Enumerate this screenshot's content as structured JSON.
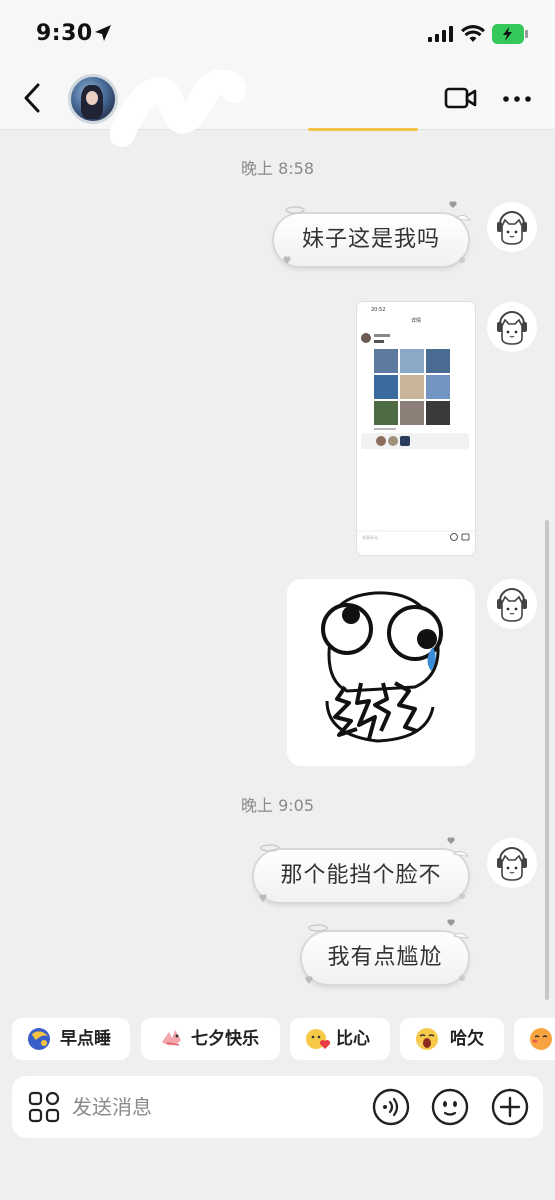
{
  "status_bar": {
    "time": "9:30"
  },
  "chat": {
    "messages": [
      {
        "type": "timestamp",
        "text": "晚上 8:58"
      },
      {
        "type": "text",
        "text": "妹子这是我吗"
      },
      {
        "type": "image",
        "content": "screenshot"
      },
      {
        "type": "image",
        "content": "meme-sticker"
      },
      {
        "type": "timestamp",
        "text": "晚上 9:05"
      },
      {
        "type": "text",
        "text": "那个能挡个脸不"
      },
      {
        "type": "text",
        "text": "我有点尴尬"
      }
    ],
    "screenshot_preview": {
      "time": "20:52",
      "title": "详情",
      "comment_placeholder": "发表评论..."
    }
  },
  "quick_replies": [
    {
      "label": "早点睡",
      "icon": "moon-emoji-icon"
    },
    {
      "label": "七夕快乐",
      "icon": "bird-emoji-icon"
    },
    {
      "label": "比心",
      "icon": "heart-hands-emoji-icon"
    },
    {
      "label": "哈欠",
      "icon": "yawn-emoji-icon"
    }
  ],
  "input": {
    "placeholder": "发送消息"
  },
  "colors": {
    "background": "#efefef",
    "bubble": "#ffffff",
    "battery": "#34c759",
    "accent": "#f2c24a"
  }
}
